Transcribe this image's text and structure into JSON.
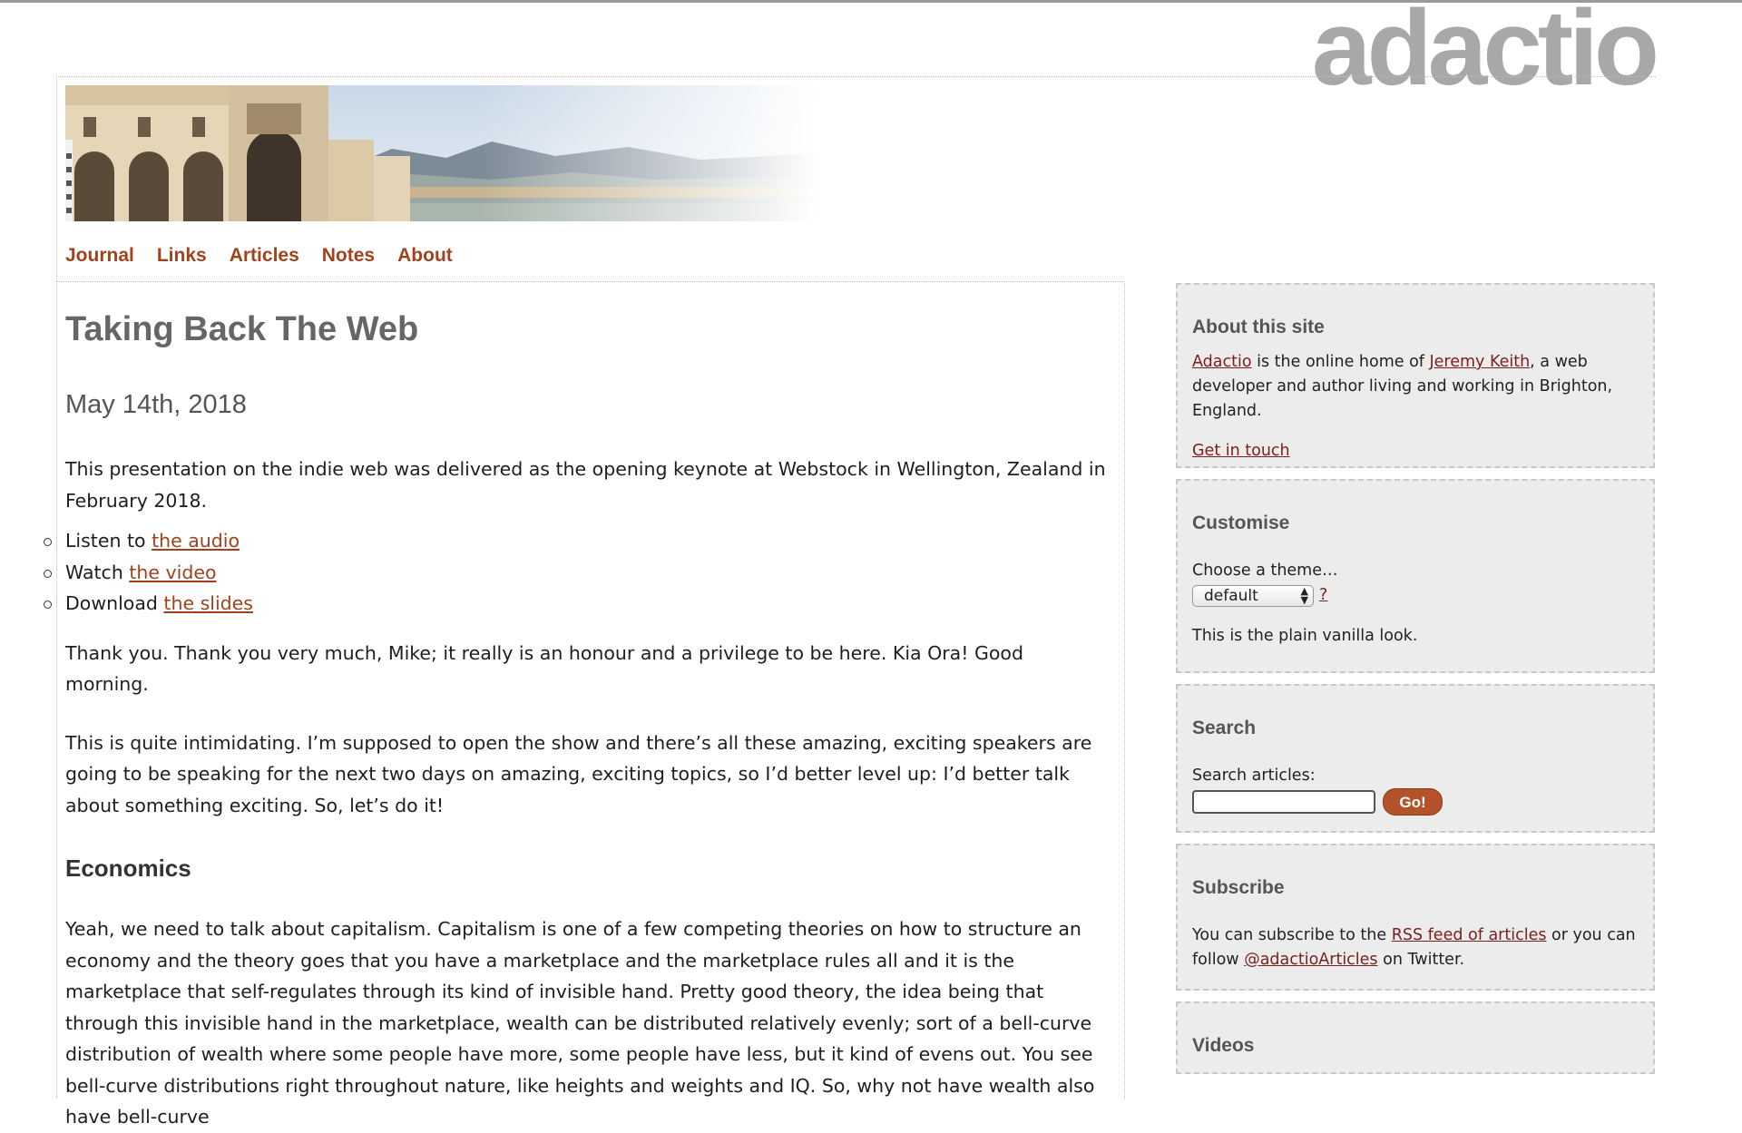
{
  "site": {
    "logo_text": "adactio"
  },
  "nav": {
    "items": [
      {
        "label": "Journal"
      },
      {
        "label": "Links"
      },
      {
        "label": "Articles"
      },
      {
        "label": "Notes"
      },
      {
        "label": "About"
      }
    ]
  },
  "article": {
    "title": "Taking Back The Web",
    "date": "May 14th, 2018",
    "intro": "This presentation on the indie web was delivered as the opening keynote at Webstock in Wellington, Zealand in February 2018.",
    "resources": [
      {
        "prefix": "Listen to ",
        "link": "the audio"
      },
      {
        "prefix": "Watch ",
        "link": "the video"
      },
      {
        "prefix": "Download ",
        "link": "the slides"
      }
    ],
    "para1": "Thank you. Thank you very much, Mike; it really is an honour and a privilege to be here. Kia Ora! Good morning.",
    "para2": "This is quite intimidating. I’m supposed to open the show and there’s all these amazing, exciting speakers are going to be speaking for the next two days on amazing, exciting topics, so I’d better level up: I’d better talk about something exciting. So, let’s do it!",
    "section_heading": "Economics",
    "para3": "Yeah, we need to talk about capitalism. Capitalism is one of a few competing theories on how to structure an economy and the theory goes that you have a marketplace and the marketplace rules all and it is the marketplace that self-regulates through its kind of invisible hand. Pretty good theory, the idea being that through this invisible hand in the marketplace, wealth can be distributed relatively evenly; sort of a bell-curve distribution of wealth where some people have more, some people have less, but it kind of evens out. You see bell-curve distributions right throughout nature, like heights and weights and IQ. So, why not have wealth also have bell-curve"
  },
  "sidebar": {
    "about": {
      "heading": "About this site",
      "link_site": "Adactio",
      "text_mid": " is the online home of ",
      "link_person": "Jeremy Keith",
      "text_end": ", a web developer and author living and working in Brighton, England.",
      "contact_link": "Get in touch"
    },
    "customise": {
      "heading": "Customise",
      "label": "Choose a theme…",
      "selected_theme": "default",
      "help_link": "?",
      "note": "This is the plain vanilla look."
    },
    "search": {
      "heading": "Search",
      "label": "Search articles:",
      "input_value": "",
      "button_label": "Go!"
    },
    "subscribe": {
      "heading": "Subscribe",
      "text_start": "You can subscribe to the ",
      "rss_link": "RSS feed of articles",
      "text_mid": " or you can follow ",
      "twitter_link": "@adactioArticles",
      "text_end": " on Twitter."
    },
    "videos": {
      "heading": "Videos"
    }
  },
  "colors": {
    "accent": "#a0431d",
    "sidebar_link": "#7a1e1e",
    "button": "#b4532a",
    "logo": "#a8a8a8"
  }
}
